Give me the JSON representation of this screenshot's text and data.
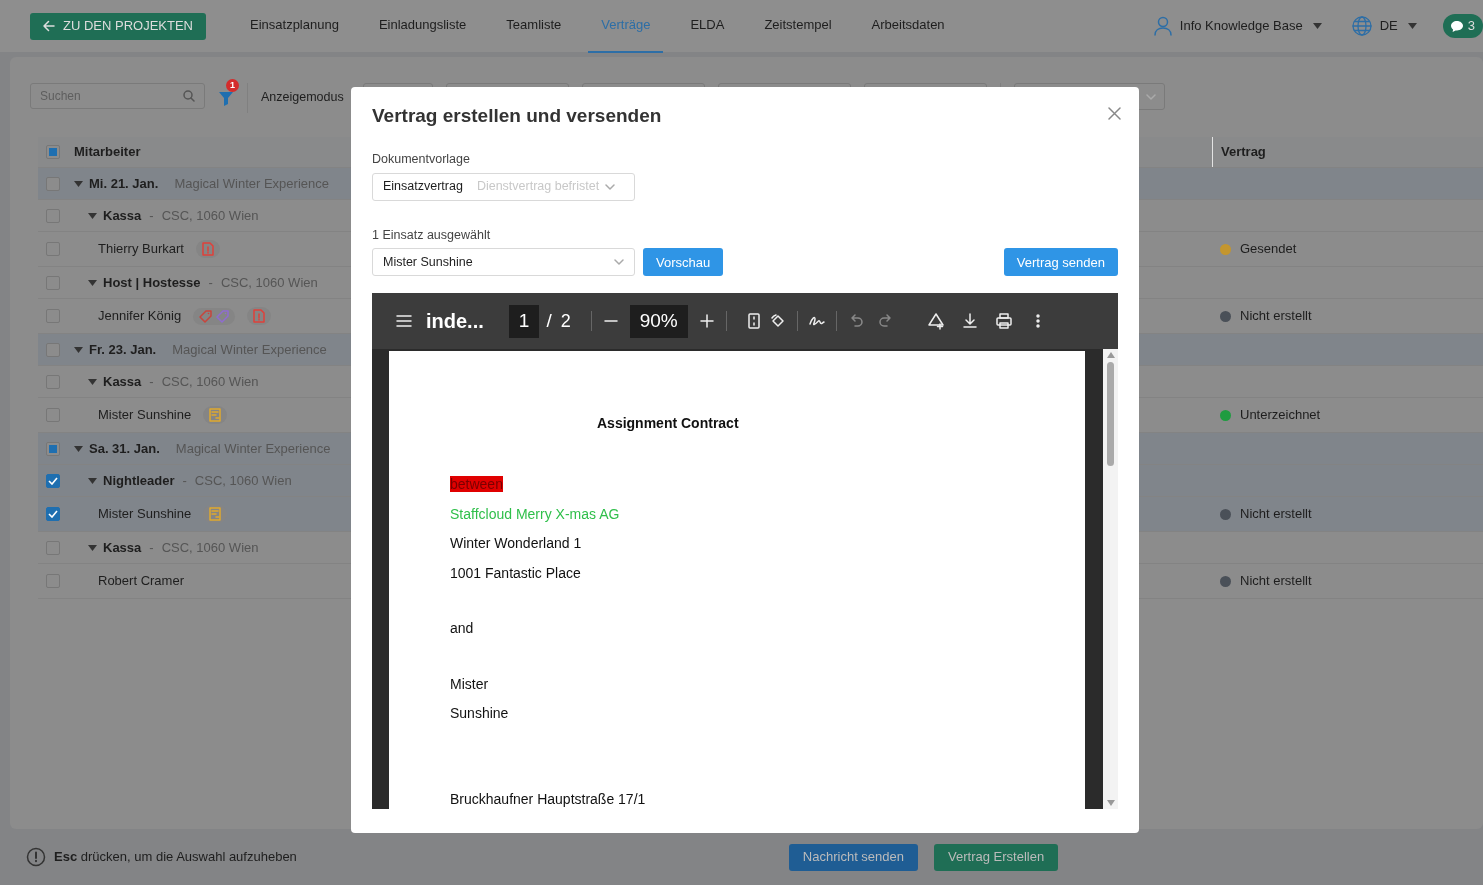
{
  "header": {
    "back_button": "ZU DEN PROJEKTEN",
    "tabs": [
      {
        "label": "Einsatzplanung",
        "selected": false
      },
      {
        "label": "Einladungsliste",
        "selected": false
      },
      {
        "label": "Teamliste",
        "selected": false
      },
      {
        "label": "Verträge",
        "selected": true
      },
      {
        "label": "ELDA",
        "selected": false
      },
      {
        "label": "Zeitstempel",
        "selected": false
      },
      {
        "label": "Arbeitsdaten",
        "selected": false
      }
    ],
    "user": "Info Knowledge Base",
    "language": "DE",
    "messages": "3"
  },
  "toolbar": {
    "search": {
      "placeholder": "Suchen"
    },
    "filter_count": "1",
    "view_mode_label": "Anzeigemodus"
  },
  "table": {
    "columns": [
      "Mitarbeiter",
      "Vertrag"
    ],
    "checked": false,
    "partial": true,
    "groups": [
      {
        "date": "Mi. 21. Jan.",
        "event": "Magical Winter Experience",
        "checked": false,
        "partial": false,
        "expanded": true,
        "children": [
          {
            "position": "Kassa",
            "separator": "-",
            "location": "CSC, 1060 Wien",
            "checked": false,
            "expanded": true,
            "children": [
              {
                "name": "Thierry Burkart",
                "checked": false,
                "document": {
                  "kind": "error"
                },
                "status": {
                  "label": "Gesendet",
                  "color": "#c4962e"
                }
              }
            ]
          },
          {
            "position": "Host | Hostesse",
            "separator": "-",
            "location": "CSC, 1060 Wien",
            "checked": false,
            "expanded": true,
            "children": [
              {
                "name": "Jennifer König",
                "checked": false,
                "tags": [
                  {
                    "color": "#c8443c"
                  },
                  {
                    "color": "#8f6cd0"
                  }
                ],
                "document": {
                  "kind": "error"
                },
                "status": {
                  "label": "Nicht erstellt",
                  "color": "#4a5058"
                }
              }
            ]
          }
        ]
      },
      {
        "date": "Fr. 23. Jan.",
        "event": "Magical Winter Experience",
        "checked": false,
        "partial": false,
        "expanded": true,
        "children": [
          {
            "position": "Kassa",
            "separator": "-",
            "location": "CSC, 1060 Wien",
            "checked": false,
            "expanded": true,
            "children": [
              {
                "name": "Mister Sunshine",
                "checked": false,
                "document": {
                  "kind": "pending"
                },
                "status": {
                  "label": "Unterzeichnet",
                  "color": "#1f9c40"
                }
              }
            ]
          }
        ]
      },
      {
        "date": "Sa. 31. Jan.",
        "event": "Magical Winter Experience",
        "checked": false,
        "partial": true,
        "expanded": true,
        "children": [
          {
            "position": "Nightleader",
            "separator": "-",
            "location": "CSC, 1060 Wien",
            "checked": true,
            "expanded": true,
            "children": [
              {
                "name": "Mister Sunshine",
                "checked": true,
                "document": {
                  "kind": "pending"
                },
                "status": {
                  "label": "Nicht erstellt",
                  "color": "#4a5058"
                }
              }
            ]
          },
          {
            "position": "Kassa",
            "separator": "-",
            "location": "CSC, 1060 Wien",
            "checked": false,
            "expanded": true,
            "children": [
              {
                "name": "Robert Cramer",
                "checked": false,
                "status": {
                  "label": "Nicht erstellt",
                  "color": "#4a5058"
                }
              }
            ]
          }
        ]
      }
    ]
  },
  "footer": {
    "hint": "**Esc** drücken, um die Auswahl aufzuheben",
    "buttons": [
      {
        "label": "Nachricht senden",
        "kind": "primary"
      },
      {
        "label": "Vertrag Erstellen",
        "kind": "success"
      }
    ]
  },
  "modal": {
    "title": "Vertrag erstellen und versenden",
    "template": {
      "label": "Dokumentvorlage",
      "value": "Einsatzvertrag",
      "hint": "Dienstvertrag befristet"
    },
    "assignment": {
      "label": "1 Einsatz ausgewählt",
      "value": "Mister Sunshine"
    },
    "buttons": [
      {
        "label": "Vorschau"
      },
      {
        "label": "Vertrag senden"
      }
    ],
    "viewer": {
      "file_name": "inde...",
      "page": "1",
      "separator": "/",
      "page_count": "2",
      "zoom": "90%",
      "undo": {
        "disabled": true
      },
      "redo": {
        "disabled": true
      },
      "document": {
        "title": "Assignment Contract",
        "paragraphs": [
          [
            {
              "text": "between",
              "kind": "highlight"
            },
            {
              "text": "Staffcloud Merry X-mas AG",
              "kind": "accent"
            },
            {
              "text": "Winter Wonderland 1",
              "kind": "plain"
            },
            {
              "text": "1001 Fantastic Place",
              "kind": "plain"
            }
          ],
          [
            {
              "text": "and",
              "kind": "plain"
            }
          ],
          [
            {
              "text": "Mister",
              "kind": "plain"
            },
            {
              "text": "Sunshine",
              "kind": "plain"
            }
          ],
          [
            {
              "text": "Bruckhaufner Hauptstraße 17/1",
              "kind": "plain"
            }
          ]
        ]
      }
    }
  }
}
